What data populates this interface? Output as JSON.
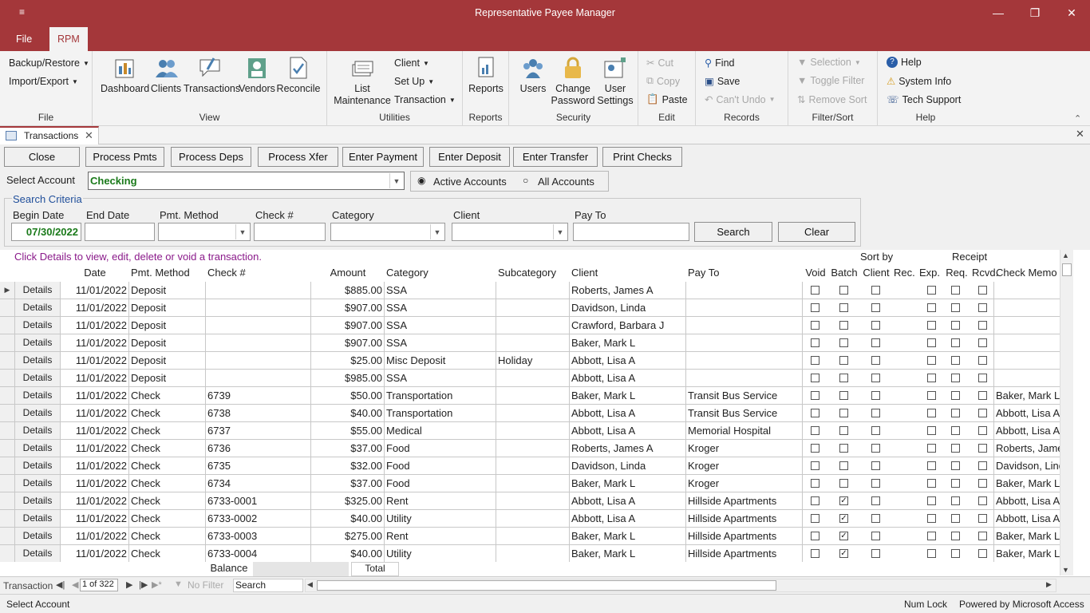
{
  "window": {
    "title": "Representative Payee Manager",
    "qat_glyph": "≡"
  },
  "ribbon_tabs": [
    "File",
    "RPM"
  ],
  "ribbon": {
    "file_group": {
      "label": "File",
      "items": [
        "Backup/Restore",
        "Import/Export"
      ]
    },
    "view_group": {
      "label": "View",
      "items": [
        "Dashboard",
        "Clients",
        "Transactions",
        "Vendors",
        "Reconcile"
      ]
    },
    "utilities_group": {
      "label": "Utilities",
      "big": "List Maintenance",
      "big_line1": "List",
      "big_line2": "Maintenance",
      "items": [
        "Client",
        "Set Up",
        "Transaction"
      ]
    },
    "reports_group": {
      "label": "Reports",
      "items": [
        "Reports"
      ]
    },
    "security_group": {
      "label": "Security",
      "items": [
        "Users"
      ],
      "change_password_1": "Change",
      "change_password_2": "Password",
      "user_settings_1": "User",
      "user_settings_2": "Settings"
    },
    "edit_group": {
      "label": "Edit",
      "items": [
        "Cut",
        "Copy",
        "Paste"
      ]
    },
    "records_group": {
      "label": "Records",
      "items": [
        "Find",
        "Save",
        "Can't Undo"
      ]
    },
    "filter_group": {
      "label": "Filter/Sort",
      "items": [
        "Selection",
        "Toggle Filter",
        "Remove Sort"
      ]
    },
    "help_group": {
      "label": "Help",
      "items": [
        "Help",
        "System Info",
        "Tech Support"
      ]
    }
  },
  "doc_tab": {
    "label": "Transactions"
  },
  "form": {
    "buttons": [
      "Close",
      "Process Pmts",
      "Process Deps",
      "Process Xfer",
      "Enter Payment",
      "Enter Deposit",
      "Enter Transfer",
      "Print Checks"
    ],
    "select_account_label": "Select Account",
    "account_value": "Checking",
    "active_accounts": "Active Accounts",
    "all_accounts": "All Accounts",
    "search_criteria_label": "Search Criteria",
    "labels": {
      "begin_date": "Begin Date",
      "end_date": "End Date",
      "pmt_method": "Pmt. Method",
      "check_no": "Check #",
      "category": "Category",
      "client": "Client",
      "pay_to": "Pay To"
    },
    "begin_date_value": "07/30/2022",
    "search_button": "Search",
    "clear_button": "Clear"
  },
  "grid": {
    "hint": "Click Details to view, edit, delete or void a transaction.",
    "header_top": {
      "sort_by": "Sort by",
      "receipt": "Receipt"
    },
    "columns": [
      "Date",
      "Pmt. Method",
      "Check #",
      "Amount",
      "Category",
      "Subcategory",
      "Client",
      "Pay To",
      "Void",
      "Batch",
      "Client",
      "Rec.",
      "Exp.",
      "Req.",
      "Rcvd.",
      "Check Memo"
    ],
    "details_label": "Details",
    "rows": [
      {
        "date": "11/01/2022",
        "method": "Deposit",
        "check": "",
        "amount": "$885.00",
        "category": "SSA",
        "sub": "",
        "client": "Roberts, James A",
        "payto": "",
        "batch": false,
        "memo": ""
      },
      {
        "date": "11/01/2022",
        "method": "Deposit",
        "check": "",
        "amount": "$907.00",
        "category": "SSA",
        "sub": "",
        "client": "Davidson, Linda",
        "payto": "",
        "batch": false,
        "memo": ""
      },
      {
        "date": "11/01/2022",
        "method": "Deposit",
        "check": "",
        "amount": "$907.00",
        "category": "SSA",
        "sub": "",
        "client": "Crawford, Barbara J",
        "payto": "",
        "batch": false,
        "memo": ""
      },
      {
        "date": "11/01/2022",
        "method": "Deposit",
        "check": "",
        "amount": "$907.00",
        "category": "SSA",
        "sub": "",
        "client": "Baker, Mark L",
        "payto": "",
        "batch": false,
        "memo": ""
      },
      {
        "date": "11/01/2022",
        "method": "Deposit",
        "check": "",
        "amount": "$25.00",
        "category": "Misc Deposit",
        "sub": "Holiday",
        "client": "Abbott, Lisa A",
        "payto": "",
        "batch": false,
        "memo": ""
      },
      {
        "date": "11/01/2022",
        "method": "Deposit",
        "check": "",
        "amount": "$985.00",
        "category": "SSA",
        "sub": "",
        "client": "Abbott, Lisa A",
        "payto": "",
        "batch": false,
        "memo": ""
      },
      {
        "date": "11/01/2022",
        "method": "Check",
        "check": "6739",
        "amount": "$50.00",
        "category": "Transportation",
        "sub": "",
        "client": "Baker, Mark L",
        "payto": "Transit Bus Service",
        "batch": false,
        "memo": "Baker, Mark L"
      },
      {
        "date": "11/01/2022",
        "method": "Check",
        "check": "6738",
        "amount": "$40.00",
        "category": "Transportation",
        "sub": "",
        "client": "Abbott, Lisa A",
        "payto": "Transit Bus Service",
        "batch": false,
        "memo": "Abbott, Lisa A"
      },
      {
        "date": "11/01/2022",
        "method": "Check",
        "check": "6737",
        "amount": "$55.00",
        "category": "Medical",
        "sub": "",
        "client": "Abbott, Lisa A",
        "payto": "Memorial Hospital",
        "batch": false,
        "memo": "Abbott, Lisa A"
      },
      {
        "date": "11/01/2022",
        "method": "Check",
        "check": "6736",
        "amount": "$37.00",
        "category": "Food",
        "sub": "",
        "client": "Roberts, James A",
        "payto": "Kroger",
        "batch": false,
        "memo": "Roberts, James A"
      },
      {
        "date": "11/01/2022",
        "method": "Check",
        "check": "6735",
        "amount": "$32.00",
        "category": "Food",
        "sub": "",
        "client": "Davidson, Linda",
        "payto": "Kroger",
        "batch": false,
        "memo": "Davidson, Linda"
      },
      {
        "date": "11/01/2022",
        "method": "Check",
        "check": "6734",
        "amount": "$37.00",
        "category": "Food",
        "sub": "",
        "client": "Baker, Mark L",
        "payto": "Kroger",
        "batch": false,
        "memo": "Baker, Mark L"
      },
      {
        "date": "11/01/2022",
        "method": "Check",
        "check": "6733-0001",
        "amount": "$325.00",
        "category": "Rent",
        "sub": "",
        "client": "Abbott, Lisa A",
        "payto": "Hillside Apartments",
        "batch": true,
        "memo": "Abbott, Lisa A"
      },
      {
        "date": "11/01/2022",
        "method": "Check",
        "check": "6733-0002",
        "amount": "$40.00",
        "category": "Utility",
        "sub": "",
        "client": "Abbott, Lisa A",
        "payto": "Hillside Apartments",
        "batch": true,
        "memo": "Abbott, Lisa A"
      },
      {
        "date": "11/01/2022",
        "method": "Check",
        "check": "6733-0003",
        "amount": "$275.00",
        "category": "Rent",
        "sub": "",
        "client": "Baker, Mark L",
        "payto": "Hillside Apartments",
        "batch": true,
        "memo": "Baker, Mark L"
      },
      {
        "date": "11/01/2022",
        "method": "Check",
        "check": "6733-0004",
        "amount": "$40.00",
        "category": "Utility",
        "sub": "",
        "client": "Baker, Mark L",
        "payto": "Hillside Apartments",
        "batch": true,
        "memo": "Baker, Mark L"
      }
    ],
    "balance_label": "Balance",
    "total_label": "Total"
  },
  "navigation": {
    "record_label": "Transaction",
    "position": "1 of 322",
    "filter": "No Filter",
    "search": "Search"
  },
  "status": {
    "left": "Select Account",
    "num_lock": "Num Lock",
    "powered_by": "Powered by Microsoft Access"
  },
  "colors": {
    "accent": "#a4373a",
    "account_text": "#1a7a1a",
    "hint_text": "#8a1a8a",
    "search_criteria": "#1f4e9a"
  }
}
